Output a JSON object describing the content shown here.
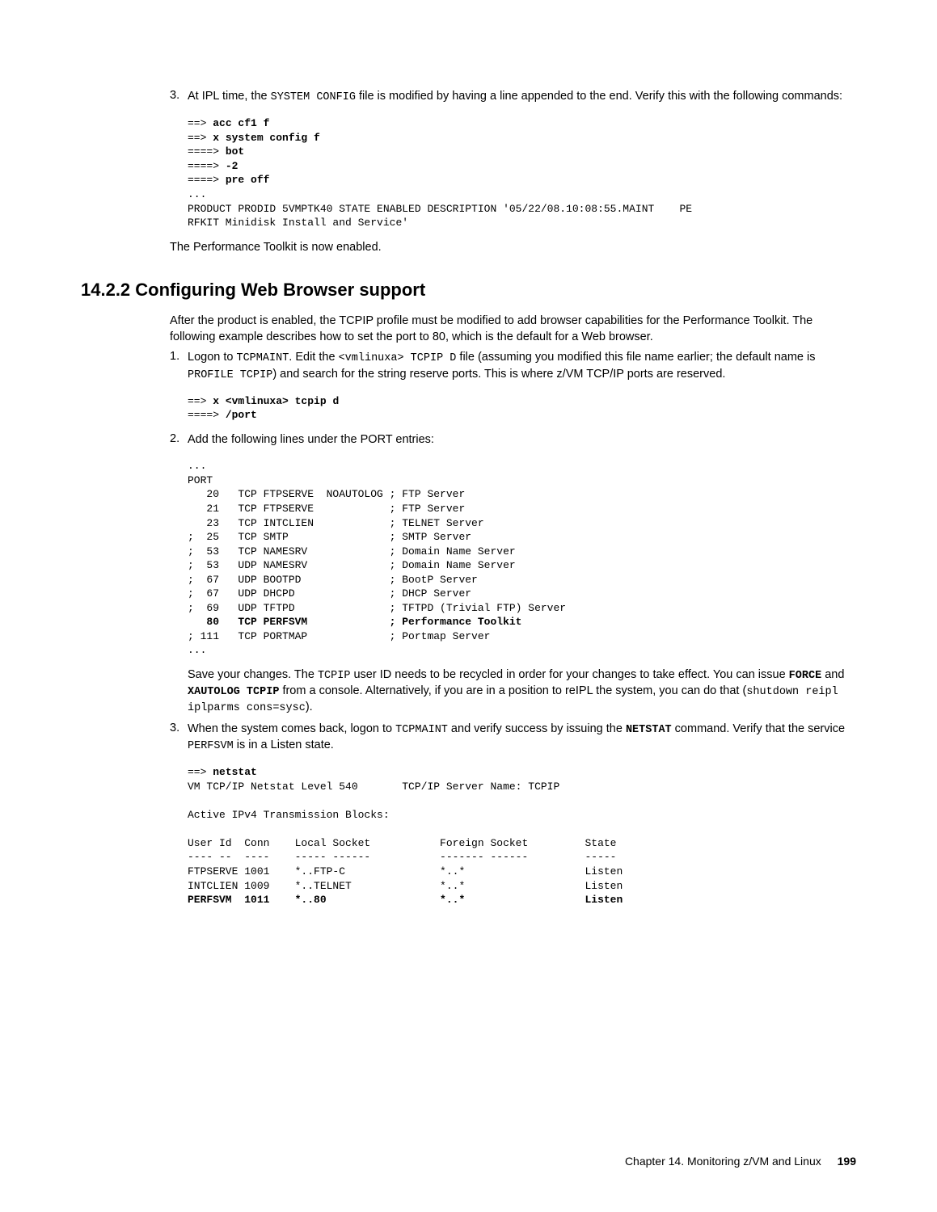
{
  "step3": {
    "num": "3.",
    "intro_a": "At IPL time, the ",
    "intro_b": "SYSTEM CONFIG",
    "intro_c": " file is modified by having a line appended to the end. Verify this with the following commands:",
    "line1a": "==> ",
    "line1b": "acc cf1 f",
    "line2a": "==> ",
    "line2b": "x system config f",
    "line3a": "====> ",
    "line3b": "bot",
    "line4a": "====> ",
    "line4b": "-2",
    "line5a": "====> ",
    "line5b": "pre off",
    "line6": "...",
    "line7": "PRODUCT PRODID 5VMPTK40 STATE ENABLED DESCRIPTION '05/22/08.10:08:55.MAINT    PE",
    "line8": "RFKIT Minidisk Install and Service'"
  },
  "enabled_text": "The Performance Toolkit is now enabled.",
  "heading": "14.2.2  Configuring Web Browser support",
  "intro_para": "After the product is enabled, the TCPIP profile must be modified to add browser capabilities for the Performance Toolkit. The following example describes how to set the port to 80, which is the default for a Web browser.",
  "s1": {
    "num": "1.",
    "a": "Logon to ",
    "b": "TCPMAINT",
    "c": ". Edit the ",
    "d": "<vmlinuxa> TCPIP D",
    "e": " file (assuming you modified this file name earlier; the default name is ",
    "f": "PROFILE TCPIP",
    "g": ") and search for the string reserve ports. This is where z/VM TCP/IP ports are reserved.",
    "l1a": "==> ",
    "l1b": "x <vmlinuxa> tcpip d",
    "l2a": "====> ",
    "l2b": "/port"
  },
  "s2": {
    "num": "2.",
    "text": "Add the following lines under the PORT entries:",
    "l1": "...",
    "l2": "PORT",
    "l3": "   20   TCP FTPSERVE  NOAUTOLOG ; FTP Server",
    "l4": "   21   TCP FTPSERVE            ; FTP Server",
    "l5": "   23   TCP INTCLIEN            ; TELNET Server",
    "l6": ";  25   TCP SMTP                ; SMTP Server",
    "l7": ";  53   TCP NAMESRV             ; Domain Name Server",
    "l8": ";  53   UDP NAMESRV             ; Domain Name Server",
    "l9": ";  67   UDP BOOTPD              ; BootP Server",
    "l10": ";  67   UDP DHCPD               ; DHCP Server",
    "l11": ";  69   UDP TFTPD               ; TFTPD (Trivial FTP) Server",
    "l12": "   80   TCP PERFSVM             ; Performance Toolkit",
    "l13": "; 111   TCP PORTMAP             ; Portmap Server",
    "l14": "...",
    "p_a": "Save your changes. The ",
    "p_b": "TCPIP",
    "p_c": " user ID needs to be recycled in order for your changes to take effect. You can issue ",
    "p_d": "FORCE",
    "p_e": " and ",
    "p_f": "XAUTOLOG TCPIP",
    "p_g": " from a console. Alternatively, if you are in a position to reIPL the system, you can do that (",
    "p_h": "shutdown reipl iplparms cons=sysc",
    "p_i": ")."
  },
  "s3": {
    "num": "3.",
    "a": "When the system comes back, logon to ",
    "b": "TCPMAINT",
    "c": " and verify success by issuing the ",
    "d": "NETSTAT",
    "e": " command. Verify that the service ",
    "f": "PERFSVM",
    "g": " is in a Listen state.",
    "l1a": "==> ",
    "l1b": "netstat",
    "l2": "VM TCP/IP Netstat Level 540       TCP/IP Server Name: TCPIP",
    "l3": "",
    "l4": "Active IPv4 Transmission Blocks:",
    "l5": "",
    "l6": "User Id  Conn    Local Socket           Foreign Socket         State",
    "l7": "---- --  ----    ----- ------           ------- ------         -----",
    "l8": "FTPSERVE 1001    *..FTP-C               *..*                   Listen",
    "l9": "INTCLIEN 1009    *..TELNET              *..*                   Listen",
    "l10": "PERFSVM  1011    *..80                  *..*                   Listen"
  },
  "footer": {
    "chapter": "Chapter 14. Monitoring z/VM and Linux",
    "page": "199"
  }
}
